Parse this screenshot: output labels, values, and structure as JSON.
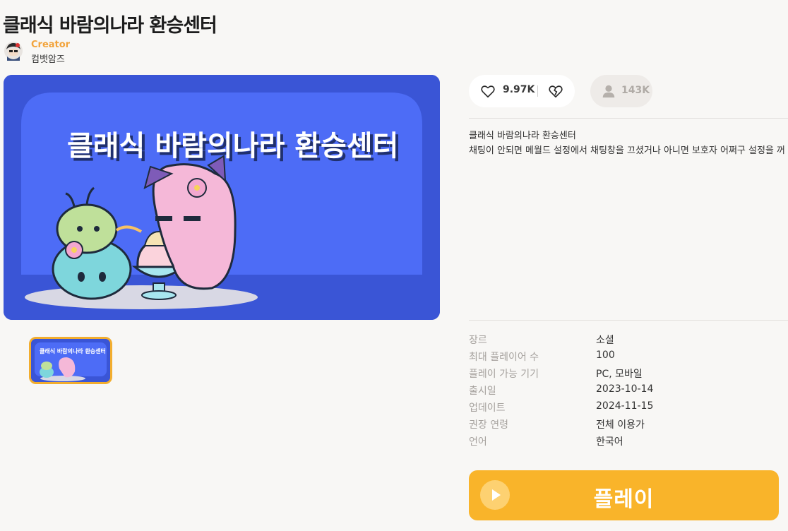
{
  "game": {
    "title": "클래식 바람의나라 환승센터",
    "banner_text": "클래식 바람의나라 환승센터"
  },
  "creator": {
    "role_label": "Creator",
    "name": "컴뱃암즈"
  },
  "stats": {
    "likes": "9.97K",
    "players": "143K"
  },
  "description": {
    "line1": "클래식 바람의나라 환승센터",
    "line2": "채팅이 안되면 메월드 설정에서 채팅창을 끄셨거나 아니면 보호자 어쩌구 설정을 꺼"
  },
  "info": [
    {
      "label": "장르",
      "value": "소셜"
    },
    {
      "label": "최대 플레이어 수",
      "value": "100"
    },
    {
      "label": "플레이 가능 기기",
      "value": "PC, 모바일"
    },
    {
      "label": "출시일",
      "value": "2023-10-14"
    },
    {
      "label": "업데이트",
      "value": "2024-11-15"
    },
    {
      "label": "권장 연령",
      "value": "전체 이용가"
    },
    {
      "label": "언어",
      "value": "한국어"
    }
  ],
  "play_button": {
    "label": "플레이"
  },
  "colors": {
    "accent": "#f9b42a",
    "creator_role": "#f2a33a",
    "banner_bg": "#3a55d6"
  },
  "icons": {
    "like": "heart-icon",
    "dislike": "broken-heart-icon",
    "players": "person-icon",
    "play": "play-icon"
  }
}
